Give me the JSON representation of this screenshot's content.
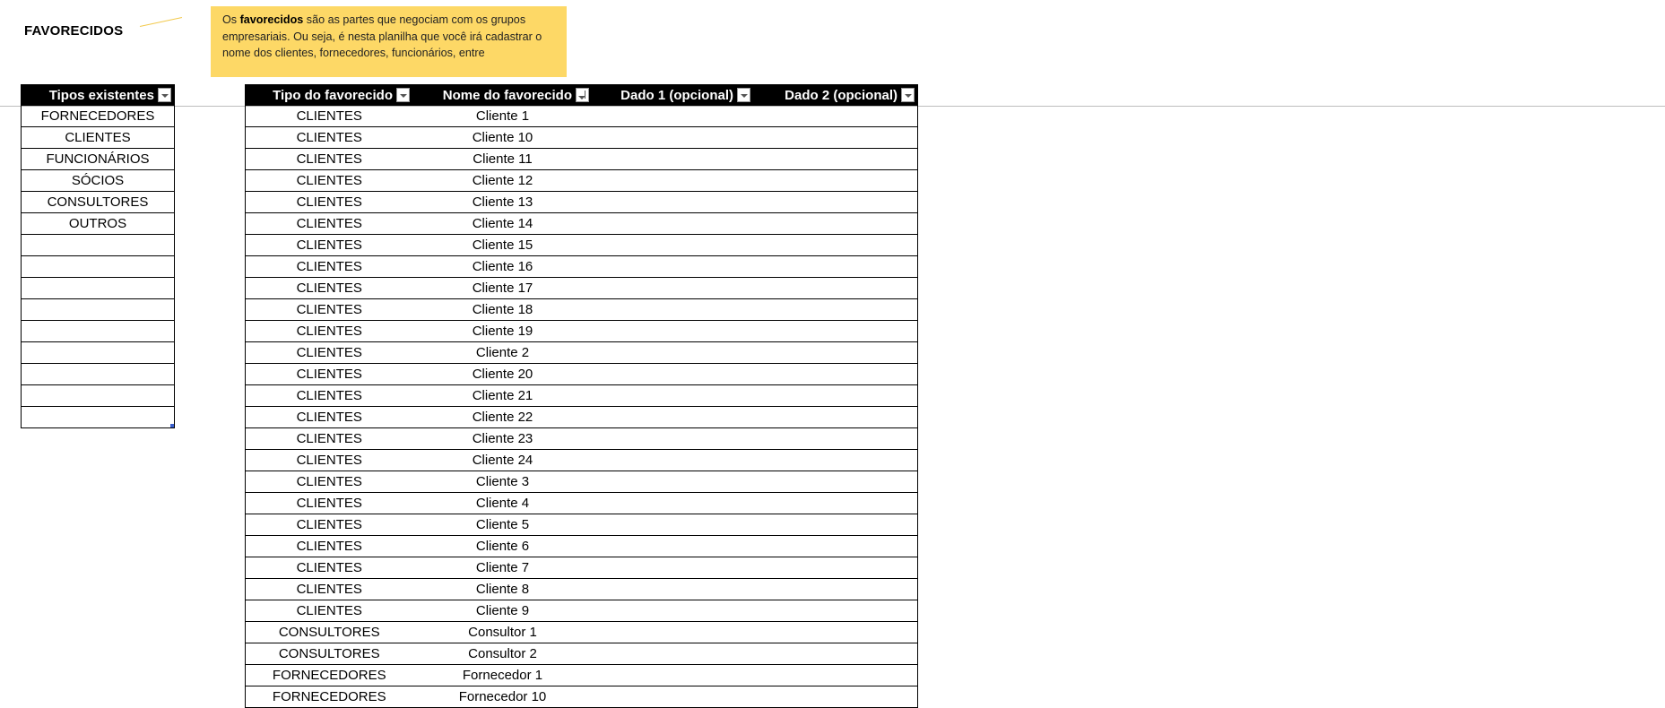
{
  "sheet": {
    "title": "FAVORECIDOS",
    "note": {
      "prefix": "Os ",
      "bold": "favorecidos",
      "suffix": " são as partes que negociam com os grupos empresariais. Ou seja, é nesta planilha que você irá cadastrar o nome dos clientes, fornecedores, funcionários, entre"
    }
  },
  "types_table": {
    "header": "Tipos existentes",
    "rows": [
      "FORNECEDORES",
      "CLIENTES",
      "FUNCIONÁRIOS",
      "SÓCIOS",
      "CONSULTORES",
      "OUTROS",
      "",
      "",
      "",
      "",
      "",
      "",
      "",
      "",
      ""
    ]
  },
  "fav_table": {
    "headers": {
      "tipo": "Tipo do favorecido",
      "nome": "Nome do favorecido",
      "dado1": "Dado 1 (opcional)",
      "dado2": "Dado 2 (opcional)"
    },
    "rows": [
      [
        "CLIENTES",
        "Cliente 1"
      ],
      [
        "CLIENTES",
        "Cliente 10"
      ],
      [
        "CLIENTES",
        "Cliente 11"
      ],
      [
        "CLIENTES",
        "Cliente 12"
      ],
      [
        "CLIENTES",
        "Cliente 13"
      ],
      [
        "CLIENTES",
        "Cliente 14"
      ],
      [
        "CLIENTES",
        "Cliente 15"
      ],
      [
        "CLIENTES",
        "Cliente 16"
      ],
      [
        "CLIENTES",
        "Cliente 17"
      ],
      [
        "CLIENTES",
        "Cliente 18"
      ],
      [
        "CLIENTES",
        "Cliente 19"
      ],
      [
        "CLIENTES",
        "Cliente 2"
      ],
      [
        "CLIENTES",
        "Cliente 20"
      ],
      [
        "CLIENTES",
        "Cliente 21"
      ],
      [
        "CLIENTES",
        "Cliente 22"
      ],
      [
        "CLIENTES",
        "Cliente 23"
      ],
      [
        "CLIENTES",
        "Cliente 24"
      ],
      [
        "CLIENTES",
        "Cliente 3"
      ],
      [
        "CLIENTES",
        "Cliente 4"
      ],
      [
        "CLIENTES",
        "Cliente 5"
      ],
      [
        "CLIENTES",
        "Cliente 6"
      ],
      [
        "CLIENTES",
        "Cliente 7"
      ],
      [
        "CLIENTES",
        "Cliente 8"
      ],
      [
        "CLIENTES",
        "Cliente 9"
      ],
      [
        "CONSULTORES",
        "Consultor 1"
      ],
      [
        "CONSULTORES",
        "Consultor 2"
      ],
      [
        "FORNECEDORES",
        "Fornecedor 1"
      ],
      [
        "FORNECEDORES",
        "Fornecedor 10"
      ]
    ]
  },
  "colors": {
    "header_bg": "#000000",
    "note_bg": "#fdd866",
    "connector": "#f2c94c"
  }
}
